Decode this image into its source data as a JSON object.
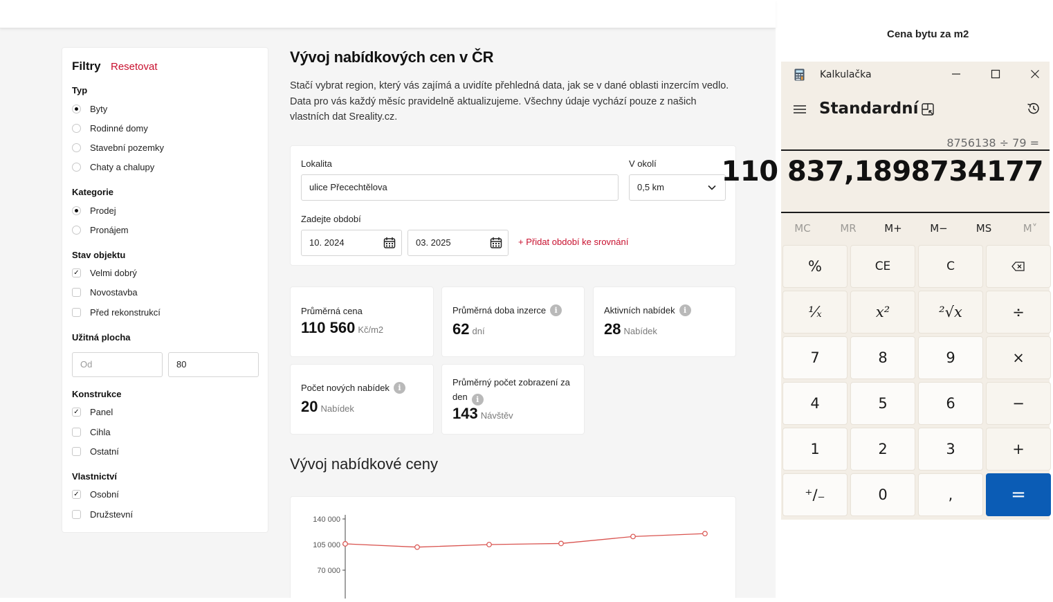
{
  "filters": {
    "title": "Filtry",
    "reset": "Resetovat",
    "typ": {
      "label": "Typ",
      "options": [
        "Byty",
        "Rodinné domy",
        "Stavební pozemky",
        "Chaty a chalupy"
      ],
      "selected": 0
    },
    "kategorie": {
      "label": "Kategorie",
      "options": [
        "Prodej",
        "Pronájem"
      ],
      "selected": 0
    },
    "stav": {
      "label": "Stav objektu",
      "options": [
        {
          "label": "Velmi dobrý",
          "checked": true
        },
        {
          "label": "Novostavba",
          "checked": false
        },
        {
          "label": "Před rekonstrukcí",
          "checked": false
        }
      ]
    },
    "plocha": {
      "label": "Užitná plocha",
      "from_placeholder": "Od",
      "to_value": "80"
    },
    "konstrukce": {
      "label": "Konstrukce",
      "options": [
        {
          "label": "Panel",
          "checked": true
        },
        {
          "label": "Cihla",
          "checked": false
        },
        {
          "label": "Ostatní",
          "checked": false
        }
      ]
    },
    "vlastnictvi": {
      "label": "Vlastnictví",
      "options": [
        {
          "label": "Osobní",
          "checked": true
        },
        {
          "label": "Družstevní",
          "checked": false
        }
      ]
    }
  },
  "main": {
    "title": "Vývoj nabídkových cen v ČR",
    "description": "Stačí vybrat region, který vás zajímá a uvidíte přehledná data, jak se v dané oblasti inzercím vedlo. Data pro vás každý měsíc pravidelně aktualizujeme. Všechny údaje vychází pouze z našich vlastních dat Sreality.cz.",
    "lokalita_label": "Lokalita",
    "lokalita_value": "ulice Přecechtělova",
    "okoli_label": "V okolí",
    "okoli_value": "0,5 km",
    "obdobi_label": "Zadejte období",
    "obdobi_from": "10. 2024",
    "obdobi_to": "03. 2025",
    "add_period": "+ Přidat období ke srovnání",
    "subtitle": "Vývoj nabídkové ceny"
  },
  "stats": [
    {
      "label": "Průměrná cena",
      "value": "110 560",
      "unit": "Kč/m2",
      "info": false
    },
    {
      "label": "Průměrná doba inzerce",
      "value": "62",
      "unit": "dní",
      "info": true
    },
    {
      "label": "Aktivních nabídek",
      "value": "28",
      "unit": "Nabídek",
      "info": true
    },
    {
      "label": "Počet nových nabídek",
      "value": "20",
      "unit": "Nabídek",
      "info": true
    },
    {
      "label": "Průměrný počet zobrazení za den",
      "value": "143",
      "unit": "Návštěv",
      "info": true
    }
  ],
  "chart_data": {
    "type": "line",
    "y_ticks": [
      "140 000",
      "105 000",
      "70 000"
    ],
    "ylim": [
      70000,
      140000
    ],
    "series": [
      {
        "values": [
          106000,
          101500,
          105000,
          106500,
          116000,
          120000
        ]
      }
    ],
    "colors": {
      "line": "#d9534f"
    }
  },
  "calculator": {
    "caption": "Cena bytu za m2",
    "app_title": "Kalkulačka",
    "mode": "Standardní",
    "expression": "8756138 ÷ 79 =",
    "result": "110 837,1898734177",
    "memory": [
      "MC",
      "MR",
      "M+",
      "M−",
      "MS",
      "M˅"
    ],
    "keys": {
      "percent": "%",
      "ce": "CE",
      "c": "C",
      "backspace": "⌫",
      "reciprocal": "¹⁄ₓ",
      "square": "x²",
      "sqrt": "²√x",
      "divide": "÷",
      "seven": "7",
      "eight": "8",
      "nine": "9",
      "multiply": "×",
      "four": "4",
      "five": "5",
      "six": "6",
      "minus": "−",
      "one": "1",
      "two": "2",
      "three": "3",
      "plus": "+",
      "negate": "⁺∕₋",
      "zero": "0",
      "comma": ",",
      "equals": "="
    },
    "accent": "#0b5cb5"
  }
}
